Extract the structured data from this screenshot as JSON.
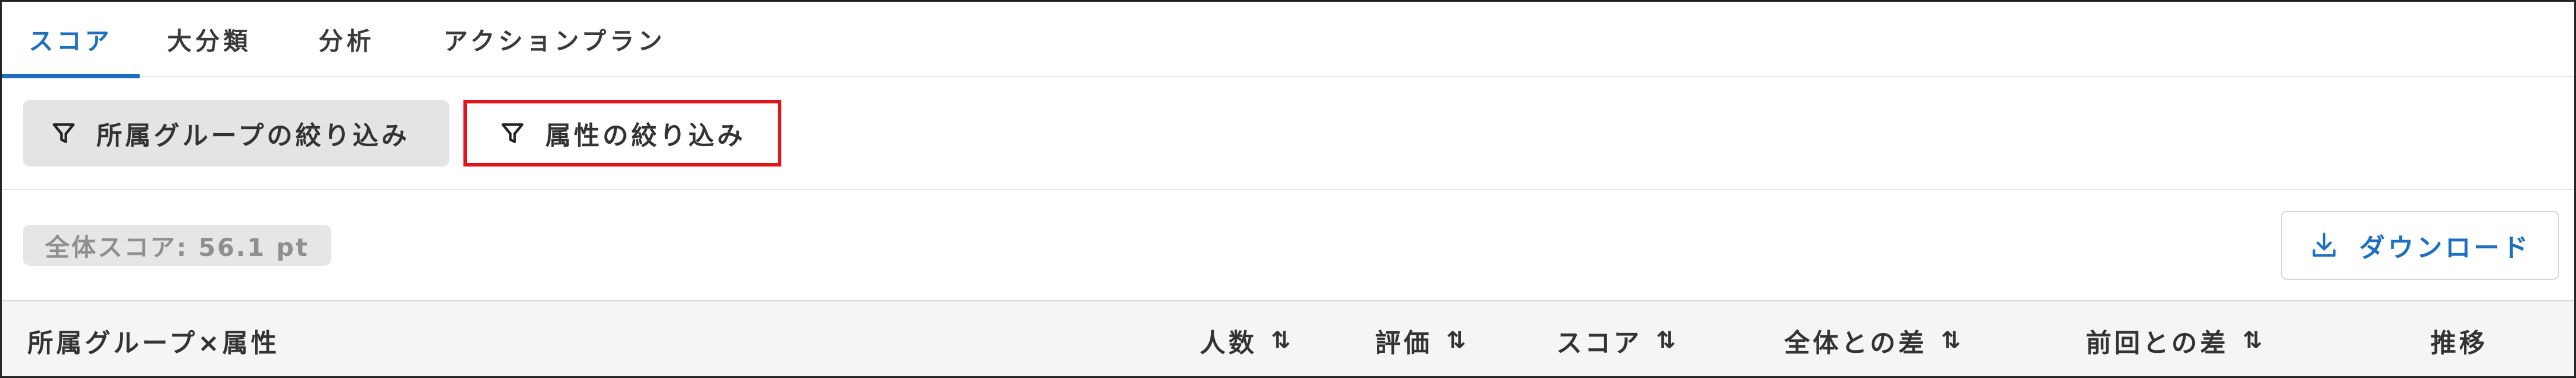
{
  "tabs": [
    {
      "label": "スコア",
      "active": true
    },
    {
      "label": "大分類",
      "active": false
    },
    {
      "label": "分析",
      "active": false
    },
    {
      "label": "アクションプラン",
      "active": false
    }
  ],
  "filters": {
    "group_label": "所属グループの絞り込み",
    "attribute_label": "属性の絞り込み",
    "icon": "filter-icon"
  },
  "score": {
    "badge_text": "全体スコア: 56.1 pt"
  },
  "download": {
    "label": "ダウンロード",
    "icon": "download-icon"
  },
  "table": {
    "headers": [
      {
        "label": "所属グループ×属性",
        "sortable": false
      },
      {
        "label": "人数",
        "sortable": true
      },
      {
        "label": "評価",
        "sortable": true
      },
      {
        "label": "スコア",
        "sortable": true
      },
      {
        "label": "全体との差",
        "sortable": true
      },
      {
        "label": "前回との差",
        "sortable": true
      },
      {
        "label": "推移",
        "sortable": false
      }
    ],
    "sort_glyph": "⇅"
  },
  "colors": {
    "accent": "#1e6fc2",
    "highlight_border": "#e4141b",
    "button_bg": "#e4e4e4",
    "header_bg": "#f5f5f5"
  }
}
